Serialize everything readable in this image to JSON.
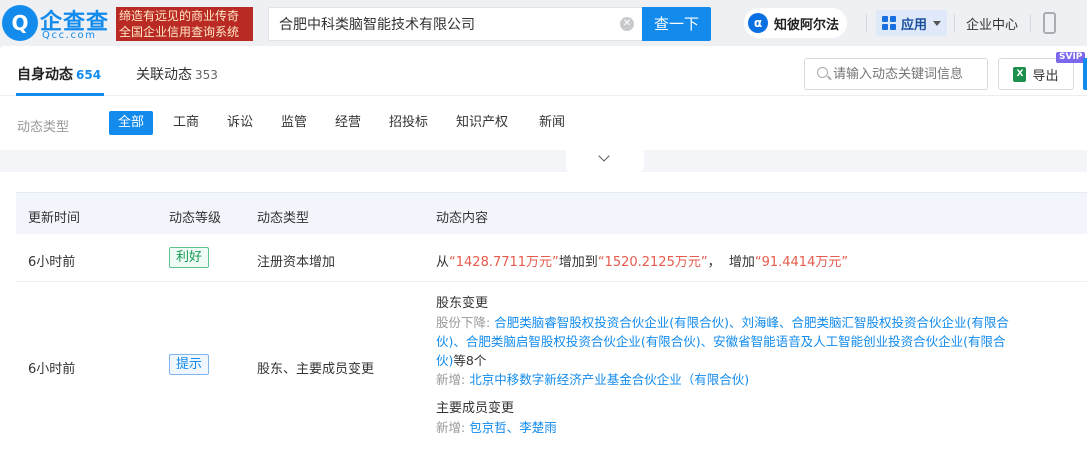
{
  "header": {
    "logo_mark": "Q",
    "logo_name": "企查查",
    "logo_domain": "Qcc.com",
    "slogan_line1": "缔造有远见的商业传奇",
    "slogan_line2": "全国企业信用查询系统",
    "search_value": "合肥中科类脑智能技术有限公司",
    "search_button": "查一下",
    "zhipo_label": "知彼阿尔法",
    "apps_label": "应用",
    "enterprise_center": "企业中心"
  },
  "tabs": [
    {
      "label": "自身动态",
      "count": "654"
    },
    {
      "label": "关联动态",
      "count": "353"
    }
  ],
  "toolbar": {
    "search_placeholder": "请输入动态关键词信息",
    "export_label": "导出",
    "svip_badge": "SVIP",
    "excel_glyph": "X"
  },
  "filters": {
    "label": "动态类型",
    "chips": [
      "全部",
      "工商",
      "诉讼",
      "监管",
      "经营",
      "招投标",
      "知识产权",
      "新闻"
    ],
    "active": "全部"
  },
  "table": {
    "columns": [
      "更新时间",
      "动态等级",
      "动态类型",
      "动态内容"
    ],
    "row1": {
      "time": "6小时前",
      "level": "利好",
      "type": "注册资本增加",
      "content": {
        "p1": "从",
        "v1": "“1428.7711万元”",
        "p2": "增加到",
        "v2": "“1520.2125万元”",
        "p3": "，  增加",
        "v3": "“91.4414万元”"
      }
    },
    "row2": {
      "time": "6小时前",
      "level": "提示",
      "type": "股东、主要成员变更",
      "shareholder_title": "股东变更",
      "decrease_label": "股份下降:",
      "decrease_line1": "合肥类脑睿智股权投资合伙企业(有限合伙)、刘海峰、合肥类脑汇智股权投资合伙企业(有限合",
      "decrease_line2": "伙)、合肥类脑启智股权投资合伙企业(有限合伙)、安徽省智能语音及人工智能创业投资合伙企业(有限合",
      "decrease_line3": "伙)",
      "decrease_suffix": "等8个",
      "added_label": "新增:",
      "added_value": "北京中移数字新经济产业基金合伙企业（有限合伙)",
      "member_title": "主要成员变更",
      "member_added_label": "新增:",
      "member_added_value": "包京哲、李楚雨"
    }
  }
}
